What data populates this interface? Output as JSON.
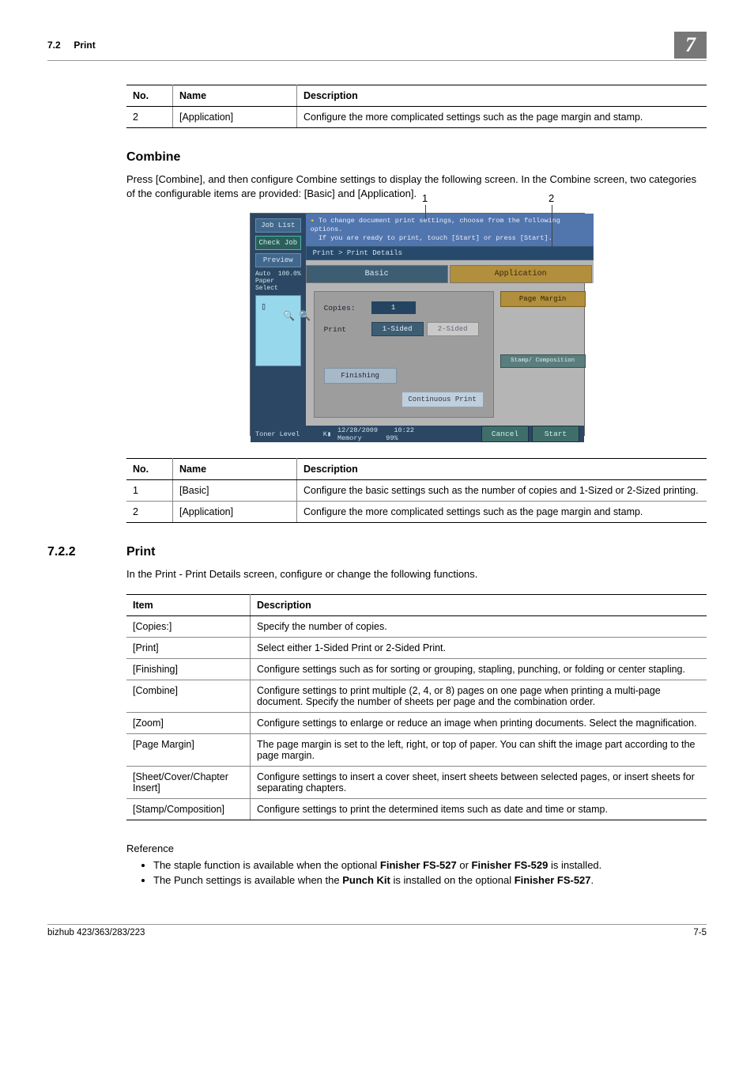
{
  "header": {
    "section": "7.2",
    "title": "Print",
    "chapter": "7"
  },
  "table1": {
    "headers": [
      "No.",
      "Name",
      "Description"
    ],
    "rows": [
      {
        "no": "2",
        "name": "[Application]",
        "desc": "Configure the more complicated settings such as the page margin and stamp."
      }
    ]
  },
  "combine": {
    "heading": "Combine",
    "intro": "Press [Combine], and then configure Combine settings to display the following screen. In the Combine screen, two categories of the configurable items are provided: [Basic] and [Application]."
  },
  "callouts": {
    "c1": "1",
    "c2": "2"
  },
  "screenshot": {
    "side": {
      "job_list": "Job List",
      "check_job": "Check Job",
      "preview": "Preview",
      "autopaper": "Auto Paper Select",
      "zoom": "100.0%",
      "toner": "Toner Level"
    },
    "msg1": "To change document print settings, choose from the following options.",
    "msg2": "If you are ready to print, touch [Start] or press [Start].",
    "crumb": "Print > Print Details",
    "tab_basic": "Basic",
    "tab_app": "Application",
    "copies_label": "Copies:",
    "copies_value": "1",
    "print_label": "Print",
    "print_1sided": "1-Sided",
    "print_2sided": "2-Sided",
    "finishing": "Finishing",
    "cont_print": "Continuous Print",
    "page_margin": "Page Margin",
    "stamp_comp": "Stamp/\nComposition",
    "date": "12/28/2009",
    "time": "10:22",
    "mem_label": "Memory",
    "mem_value": "99%",
    "cancel": "Cancel",
    "start": "Start"
  },
  "table2": {
    "headers": [
      "No.",
      "Name",
      "Description"
    ],
    "rows": [
      {
        "no": "1",
        "name": "[Basic]",
        "desc": "Configure the basic settings such as the number of copies and 1-Sized or 2-Sized printing."
      },
      {
        "no": "2",
        "name": "[Application]",
        "desc": "Configure the more complicated settings such as the page margin and stamp."
      }
    ]
  },
  "sec722": {
    "num": "7.2.2",
    "title": "Print",
    "intro": "In the Print - Print Details screen, configure or change the following functions."
  },
  "table3": {
    "headers": [
      "Item",
      "Description"
    ],
    "rows": [
      {
        "item": "[Copies:]",
        "desc": "Specify the number of copies."
      },
      {
        "item": "[Print]",
        "desc": "Select either 1-Sided Print or 2-Sided Print."
      },
      {
        "item": "[Finishing]",
        "desc": "Configure settings such as for sorting or grouping, stapling, punching, or folding or center stapling."
      },
      {
        "item": "[Combine]",
        "desc": "Configure settings to print multiple (2, 4, or 8) pages on one page when printing a multi-page document. Specify the number of sheets per page and the combination order."
      },
      {
        "item": "[Zoom]",
        "desc": "Configure settings to enlarge or reduce an image when printing documents. Select the magnification."
      },
      {
        "item": "[Page Margin]",
        "desc": "The page margin is set to the left, right, or top of paper. You can shift the image part according to the page margin."
      },
      {
        "item": "[Sheet/Cover/Chapter Insert]",
        "desc": "Configure settings to insert a cover sheet, insert sheets between selected pages, or insert sheets for separating chapters."
      },
      {
        "item": "[Stamp/Composition]",
        "desc": "Configure settings to print the determined items such as date and time or stamp."
      }
    ]
  },
  "reference": {
    "title": "Reference",
    "items": [
      {
        "pre": "The staple function is available when the optional ",
        "b1": "Finisher FS-527",
        "mid": " or ",
        "b2": "Finisher FS-529",
        "post": " is installed."
      },
      {
        "pre": "The Punch settings is available when the ",
        "b1": "Punch Kit",
        "mid": " is installed on the optional ",
        "b2": "Finisher FS-527",
        "post": "."
      }
    ]
  },
  "footer": {
    "left": "bizhub 423/363/283/223",
    "right": "7-5"
  }
}
